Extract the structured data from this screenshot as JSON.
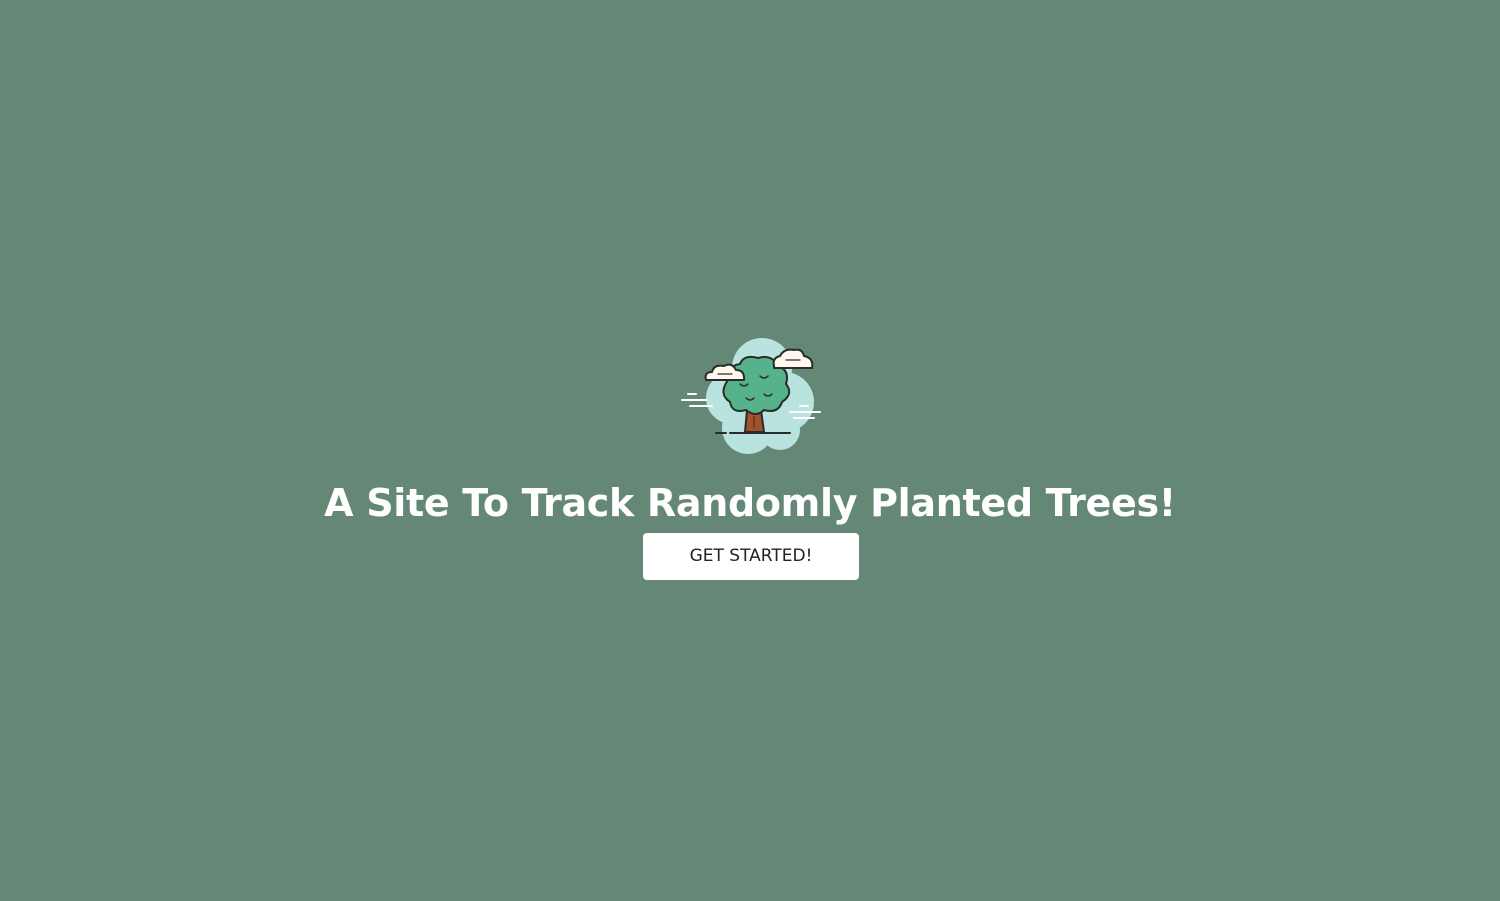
{
  "hero": {
    "logo_icon": "tree-cloud-icon",
    "title": "A Site To Track Randomly Planted Trees!",
    "cta_label": "GET STARTED!"
  },
  "colors": {
    "background": "#658775",
    "title_text": "#ffffff",
    "button_bg": "#ffffff",
    "button_text": "#222222",
    "cloud_bubble": "#b9e3df",
    "foliage": "#56b28a",
    "trunk": "#a0522d",
    "small_clouds": "#fff8ee"
  }
}
